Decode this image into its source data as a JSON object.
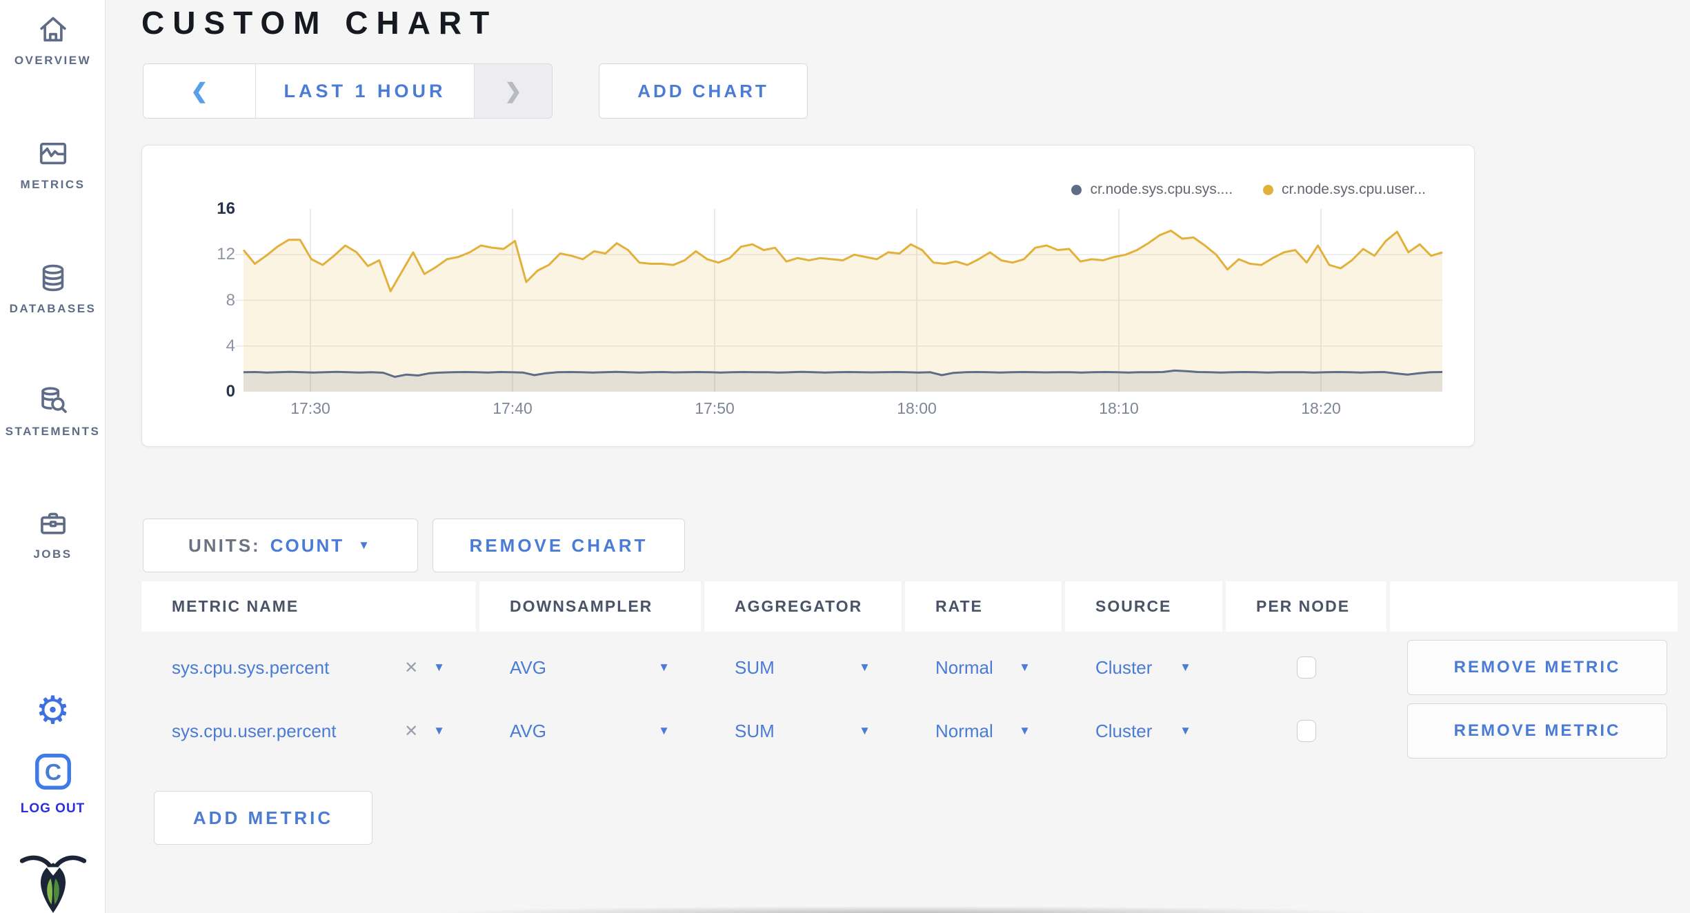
{
  "header": {
    "title": "CUSTOM CHART"
  },
  "toolbar": {
    "time_range": "LAST 1 HOUR",
    "add_chart": "ADD CHART"
  },
  "icons": {
    "chevron_left": "❮",
    "chevron_right": "❯",
    "dropdown_caret": "▼",
    "clear_x": "✕"
  },
  "sidebar": {
    "items": [
      {
        "label": "OVERVIEW",
        "icon": "home-icon"
      },
      {
        "label": "METRICS",
        "icon": "metrics-icon"
      },
      {
        "label": "DATABASES",
        "icon": "databases-icon"
      },
      {
        "label": "STATEMENTS",
        "icon": "statements-icon"
      },
      {
        "label": "JOBS",
        "icon": "jobs-icon"
      }
    ],
    "logout_label": "LOG OUT"
  },
  "chart_card": {
    "legend": [
      {
        "label": "cr.node.sys.cpu.sys....",
        "color": "#5f6c87"
      },
      {
        "label": "cr.node.sys.cpu.user...",
        "color": "#e2b13c"
      }
    ]
  },
  "chart_data": {
    "type": "line",
    "title": "",
    "xlabel": "",
    "ylabel": "",
    "x_ticks": [
      "17:30",
      "17:40",
      "17:50",
      "18:00",
      "18:10",
      "18:20"
    ],
    "x_domain": [
      "17:26:30",
      "18:25:30"
    ],
    "y_ticks": [
      16,
      12,
      8,
      4,
      0
    ],
    "ylim": [
      0,
      16
    ],
    "grid": true,
    "legend_position": "top-right",
    "series": [
      {
        "name": "cr.node.sys.cpu.user.percent",
        "color": "#e2b13c",
        "fill": "rgba(226,177,60,0.14)",
        "values": [
          12.4,
          11.2,
          11.9,
          12.7,
          13.3,
          13.3,
          11.6,
          11.1,
          11.9,
          12.8,
          12.2,
          11.0,
          11.5,
          8.8,
          10.5,
          12.2,
          10.3,
          10.9,
          11.6,
          11.8,
          12.2,
          12.8,
          12.6,
          12.5,
          13.2,
          9.6,
          10.6,
          11.1,
          12.1,
          11.9,
          11.6,
          12.3,
          12.1,
          13.0,
          12.4,
          11.3,
          11.2,
          11.2,
          11.1,
          11.5,
          12.3,
          11.6,
          11.3,
          11.7,
          12.7,
          12.9,
          12.4,
          12.6,
          11.4,
          11.7,
          11.5,
          11.7,
          11.6,
          11.5,
          12.0,
          11.8,
          11.6,
          12.2,
          12.1,
          12.9,
          12.4,
          11.3,
          11.2,
          11.4,
          11.1,
          11.6,
          12.2,
          11.5,
          11.3,
          11.6,
          12.6,
          12.8,
          12.4,
          12.5,
          11.4,
          11.6,
          11.5,
          11.8,
          12.0,
          12.4,
          13.0,
          13.7,
          14.1,
          13.4,
          13.5,
          12.8,
          12.0,
          10.7,
          11.6,
          11.2,
          11.1,
          11.7,
          12.2,
          12.4,
          11.3,
          12.8,
          11.1,
          10.8,
          11.5,
          12.5,
          11.9,
          13.2,
          14.0,
          12.2,
          12.9,
          11.9,
          12.2
        ]
      },
      {
        "name": "cr.node.sys.cpu.sys.percent",
        "color": "#5f6c87",
        "fill": "rgba(95,108,135,0.14)",
        "values": [
          1.7,
          1.72,
          1.68,
          1.7,
          1.74,
          1.7,
          1.67,
          1.7,
          1.73,
          1.7,
          1.68,
          1.71,
          1.66,
          1.3,
          1.5,
          1.42,
          1.62,
          1.68,
          1.7,
          1.72,
          1.7,
          1.68,
          1.72,
          1.7,
          1.68,
          1.45,
          1.62,
          1.7,
          1.72,
          1.7,
          1.68,
          1.7,
          1.73,
          1.7,
          1.68,
          1.7,
          1.72,
          1.69,
          1.7,
          1.72,
          1.7,
          1.68,
          1.7,
          1.72,
          1.7,
          1.7,
          1.68,
          1.7,
          1.73,
          1.7,
          1.68,
          1.7,
          1.72,
          1.7,
          1.69,
          1.7,
          1.72,
          1.7,
          1.68,
          1.7,
          1.45,
          1.65,
          1.7,
          1.72,
          1.7,
          1.68,
          1.7,
          1.72,
          1.7,
          1.69,
          1.71,
          1.7,
          1.68,
          1.7,
          1.72,
          1.7,
          1.68,
          1.71,
          1.7,
          1.72,
          1.85,
          1.8,
          1.72,
          1.7,
          1.68,
          1.7,
          1.72,
          1.7,
          1.68,
          1.7,
          1.71,
          1.7,
          1.68,
          1.7,
          1.72,
          1.7,
          1.68,
          1.7,
          1.72,
          1.6,
          1.5,
          1.62,
          1.7,
          1.72
        ]
      }
    ]
  },
  "units_bar": {
    "units_label": "UNITS:",
    "units_value": "COUNT",
    "remove_chart": "REMOVE CHART"
  },
  "table": {
    "columns": [
      "METRIC NAME",
      "DOWNSAMPLER",
      "AGGREGATOR",
      "RATE",
      "SOURCE",
      "PER NODE",
      ""
    ],
    "rows": [
      {
        "metric": "sys.cpu.sys.percent",
        "downsampler": "AVG",
        "aggregator": "SUM",
        "rate": "Normal",
        "source": "Cluster",
        "per_node": false,
        "remove": "REMOVE METRIC"
      },
      {
        "metric": "sys.cpu.user.percent",
        "downsampler": "AVG",
        "aggregator": "SUM",
        "rate": "Normal",
        "source": "Cluster",
        "per_node": false,
        "remove": "REMOVE METRIC"
      }
    ]
  },
  "add_metric_label": "ADD METRIC"
}
